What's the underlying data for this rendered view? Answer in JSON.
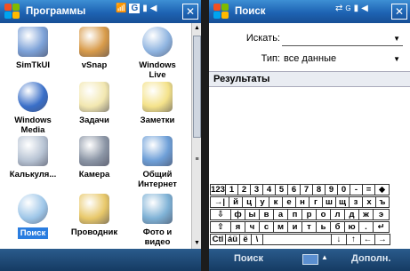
{
  "left_window": {
    "title": "Программы",
    "status_icons": [
      "signal-phone-icon",
      "g-network-icon",
      "signal-bars-icon",
      "speaker-icon"
    ],
    "apps": [
      {
        "label": "SimTkUI",
        "icon": "sim-toolkit-icon"
      },
      {
        "label": "vSnap",
        "icon": "camera-snap-icon"
      },
      {
        "label": "Windows\nLive",
        "icon": "windows-live-icon"
      },
      {
        "label": "Windows\nMedia",
        "icon": "windows-media-icon"
      },
      {
        "label": "Задачи",
        "icon": "tasks-icon"
      },
      {
        "label": "Заметки",
        "icon": "notes-icon"
      },
      {
        "label": "Калькуля...",
        "icon": "calculator-icon"
      },
      {
        "label": "Камера",
        "icon": "camera-icon"
      },
      {
        "label": "Общий\nИнтернет",
        "icon": "internet-sharing-icon"
      },
      {
        "label": "Поиск",
        "icon": "search-magnifier-icon",
        "selected": true
      },
      {
        "label": "Проводник",
        "icon": "file-explorer-icon"
      },
      {
        "label": "Фото и\nвидео",
        "icon": "photos-video-icon"
      }
    ]
  },
  "right_window": {
    "title": "Поиск",
    "search_label": "Искать:",
    "search_value": "",
    "type_label": "Тип:",
    "type_value": "все данные",
    "results_header": "Результаты",
    "softkey_left": "Поиск",
    "softkey_right": "Дополн.",
    "keyboard": {
      "row1": [
        "123",
        "1",
        "2",
        "3",
        "4",
        "5",
        "6",
        "7",
        "8",
        "9",
        "0",
        "-",
        "=",
        "◆"
      ],
      "row2": [
        "→|",
        "й",
        "ц",
        "у",
        "к",
        "е",
        "н",
        "г",
        "ш",
        "щ",
        "з",
        "х",
        "ъ"
      ],
      "row3": [
        "⇩",
        "ф",
        "ы",
        "в",
        "а",
        "п",
        "р",
        "о",
        "л",
        "д",
        "ж",
        "э"
      ],
      "row4": [
        "⇧",
        "я",
        "ч",
        "с",
        "м",
        "и",
        "т",
        "ь",
        "б",
        "ю",
        ".",
        "↵"
      ],
      "row5": [
        "Ctl",
        "áü",
        "ё",
        "\\",
        "",
        "↓",
        "↑",
        "←",
        "→"
      ]
    }
  },
  "colors": {
    "titlebar": "#1e63b3",
    "selection": "#2a7de0",
    "softbar": "#153b63"
  }
}
